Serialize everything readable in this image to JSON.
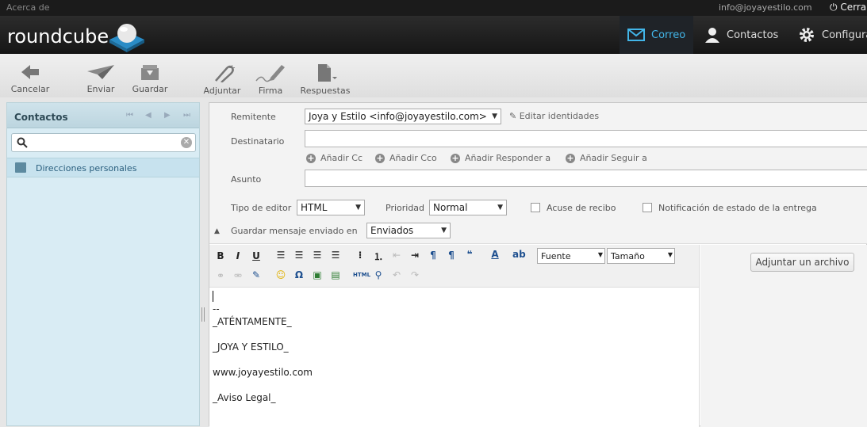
{
  "topbar": {
    "about": "Acerca de",
    "user": "info@joyayestilo.com",
    "logout": "Cerrar"
  },
  "header": {
    "logo": "roundcube",
    "nav": [
      {
        "label": "Correo",
        "icon": "envelope-icon",
        "active": true
      },
      {
        "label": "Contactos",
        "icon": "person-icon"
      },
      {
        "label": "Configuración",
        "icon": "gear-icon"
      }
    ]
  },
  "toolbar": {
    "cancel": "Cancelar",
    "send": "Enviar",
    "save": "Guardar",
    "attach": "Adjuntar",
    "signature": "Firma",
    "responses": "Respuestas"
  },
  "sidebar": {
    "title": "Contactos",
    "search_placeholder": "",
    "addressbook": "Direcciones personales"
  },
  "compose": {
    "from_label": "Remitente",
    "from_value": "Joya y Estilo <info@joyayestilo.com>",
    "edit_identities": "Editar identidades",
    "to_label": "Destinatario",
    "add_links": [
      "Añadir Cc",
      "Añadir Cco",
      "Añadir Responder a",
      "Añadir Seguir a"
    ],
    "subject_label": "Asunto",
    "editor_type_label": "Tipo de editor",
    "editor_type_value": "HTML",
    "priority_label": "Prioridad",
    "priority_value": "Normal",
    "receipt_label": "Acuse de recibo",
    "dsn_label": "Notificación de estado de la entrega",
    "save_sent_label": "Guardar mensaje enviado en",
    "save_sent_value": "Enviados"
  },
  "editor": {
    "font_label": "Fuente",
    "size_label": "Tamaño",
    "body_lines": [
      "--",
      "_ATÉNTAMENTE_",
      "_JOYA Y ESTILO_",
      "www.joyayestilo.com",
      "_Aviso Legal_"
    ]
  },
  "attachments": {
    "button": "Adjuntar un archivo"
  },
  "colors": {
    "accent": "#42b5e8",
    "header_bg": "#1b1b1b",
    "sidebar_bg": "#d9ecf4"
  }
}
